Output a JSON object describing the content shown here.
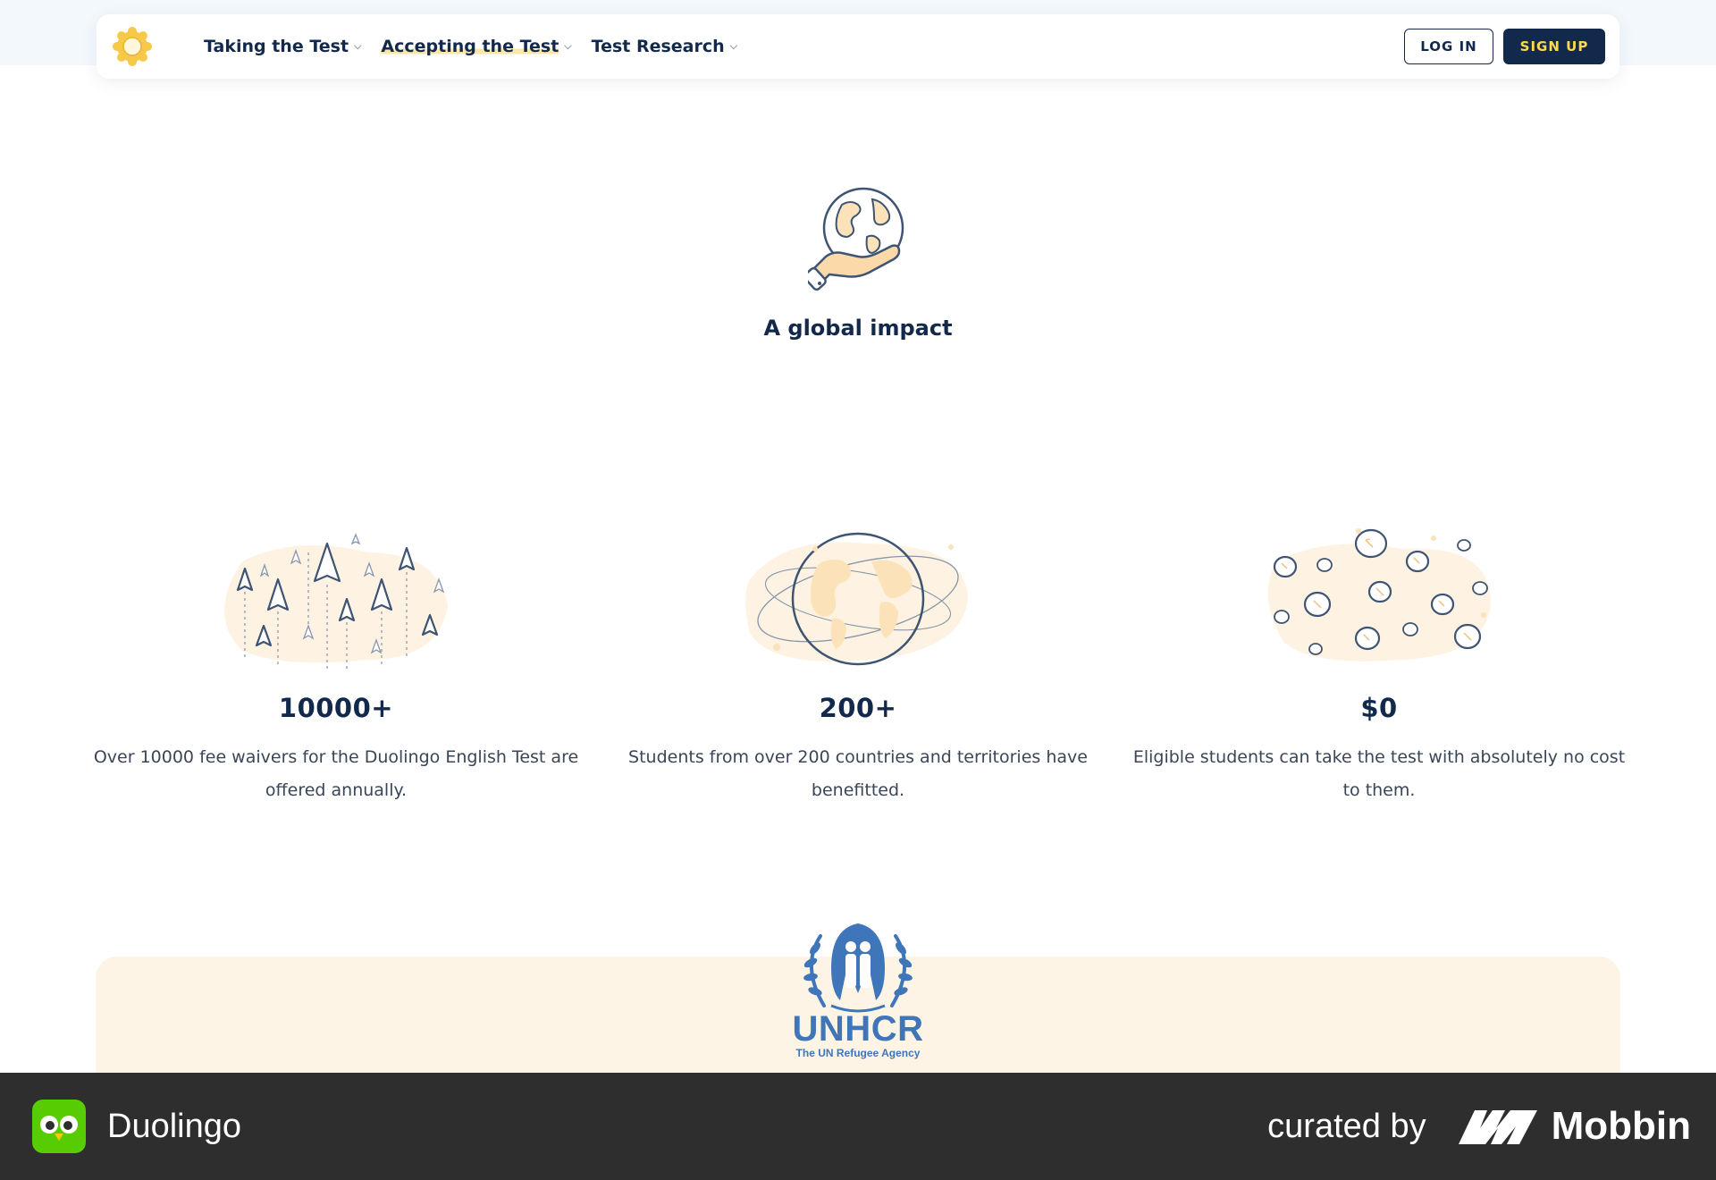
{
  "nav": {
    "logo_icon": "sun-badge-icon",
    "links": [
      {
        "label": "Taking the Test",
        "active": false
      },
      {
        "label": "Accepting the Test",
        "active": true
      },
      {
        "label": "Test Research",
        "active": false
      }
    ],
    "login_label": "LOG IN",
    "signup_label": "SIGN UP"
  },
  "hero": {
    "icon": "globe-in-hand-icon",
    "title": "A global impact"
  },
  "stats": [
    {
      "icon": "paper-planes-illustration",
      "number": "10000+",
      "description": "Over 10000 fee waivers for the Duolingo English Test are offered annually."
    },
    {
      "icon": "world-globe-illustration",
      "number": "200+",
      "description": "Students from over 200 countries and territories have benefitted."
    },
    {
      "icon": "coins-illustration",
      "number": "$0",
      "description": "Eligible students can take the test with absolutely no cost to them."
    }
  ],
  "partner": {
    "logo_icon": "unhcr-emblem-icon",
    "name": "UNHCR",
    "tagline": "The UN Refugee Agency"
  },
  "footer": {
    "app_name": "Duolingo",
    "curated_label": "curated by",
    "brand": "Mobbin"
  },
  "colors": {
    "navy": "#13294b",
    "yellow": "#ffd84d",
    "cream": "#fef4e6",
    "unhcr_blue": "#3f75b9",
    "footer_bg": "#2e2e2e"
  }
}
